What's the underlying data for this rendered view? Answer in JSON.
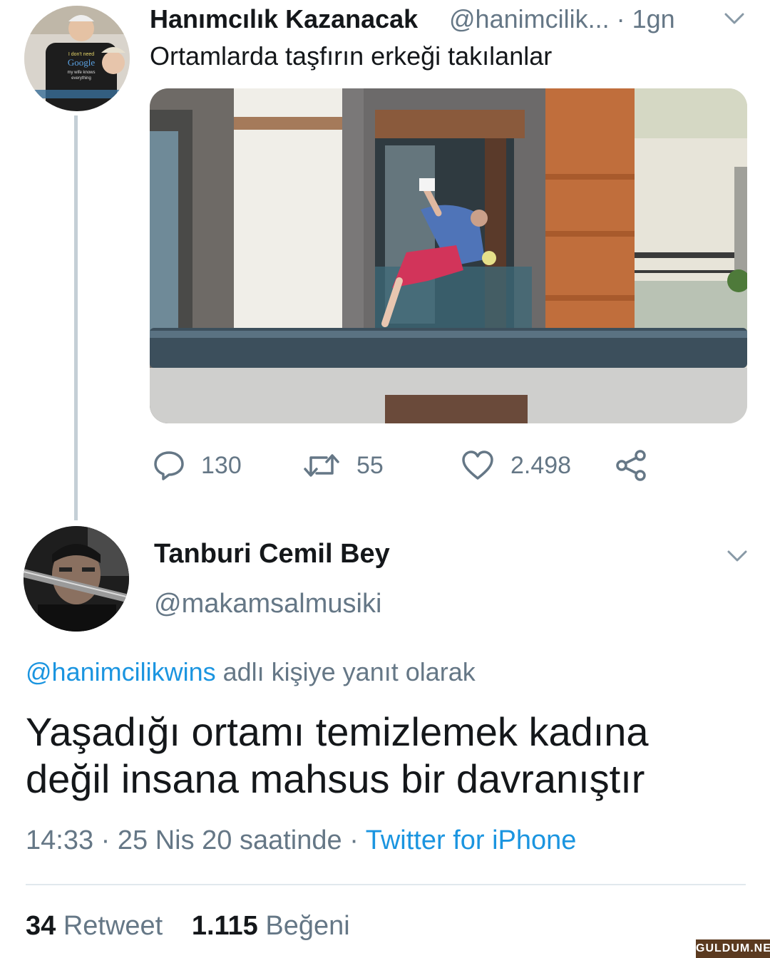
{
  "tweet1": {
    "display_name": "Hanımcılık Kazanacak",
    "handle_time": "@hanimcilik... · 1gn",
    "text": "Ortamlarda taşfırın erkeği takılanlar",
    "actions": {
      "reply_count": "130",
      "retweet_count": "55",
      "like_count": "2.498"
    },
    "avatar_shirt_text": [
      "I don't need",
      "Google",
      "my wife knows",
      "everything"
    ]
  },
  "tweet2": {
    "display_name": "Tanburi Cemil Bey",
    "handle": "@makamsalmusiki",
    "reply_to_mention": "@hanimcilikwins",
    "reply_to_suffix": " adlı kişiye yanıt olarak",
    "text_line1": "Yaşadığı ortamı temizlemek kadına",
    "text_line2": "değil insana mahsus bir davranıştır",
    "time": "14:33",
    "separator": " · ",
    "date": "25 Nis 20 saatinde",
    "source": "Twitter for iPhone",
    "retweet_count": "34",
    "retweet_label": " Retweet",
    "like_count": "1.115",
    "like_label": " Beğeni"
  },
  "watermark": "GULDUM.NET",
  "icons": {
    "reply": "speech-bubble-icon",
    "retweet": "retweet-arrows-icon",
    "like": "heart-icon",
    "share": "share-nodes-icon",
    "menu": "chevron-down-icon"
  },
  "colors": {
    "link": "#1b95e0",
    "secondary_text": "#657786",
    "primary_text": "#14171a",
    "thread_line": "#c4cfd6"
  }
}
